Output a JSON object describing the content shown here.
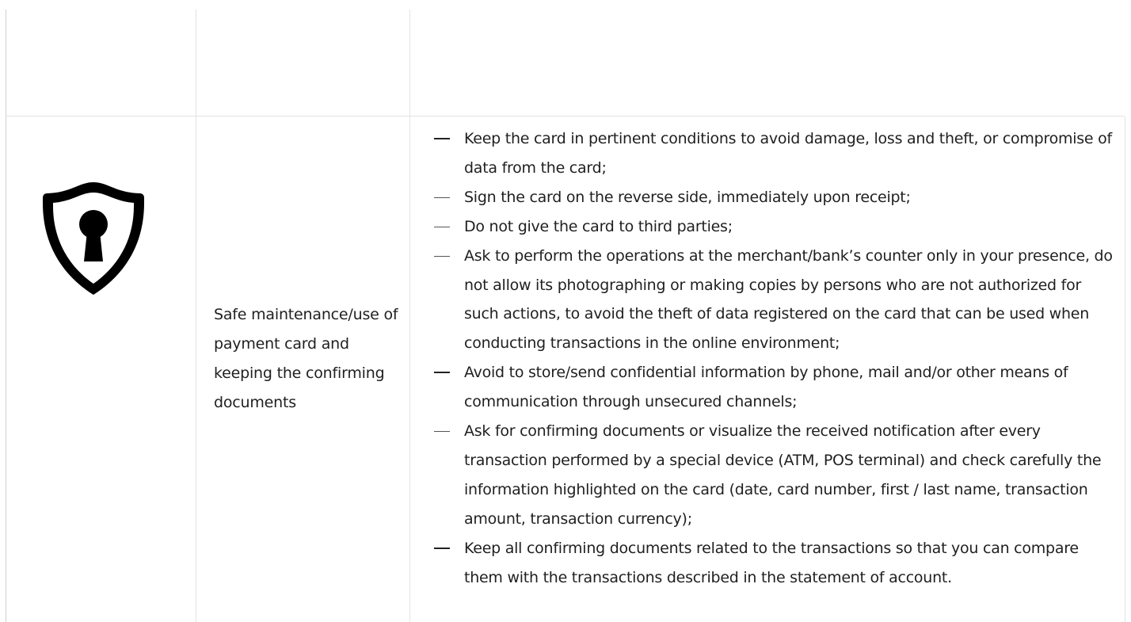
{
  "section": {
    "title": "Safe maintenance/use of payment card and keeping the confirming documents",
    "icon": "shield-keyhole-icon",
    "rules": [
      {
        "text": "Keep the card in pertinent conditions to avoid damage, loss and theft, or compromise of data from the card;",
        "bold_dash": true
      },
      {
        "text": "Sign the card on the reverse side, immediately upon receipt;",
        "bold_dash": false
      },
      {
        "text": "Do not give the card to third parties;",
        "bold_dash": false
      },
      {
        "text": "Ask to perform the operations at the merchant/bank’s counter only in your presence, do not allow its photographing or making copies by persons who are not authorized for such actions, to avoid the theft of data registered on the card that can be used when conducting transactions in the online environment;",
        "bold_dash": false
      },
      {
        "text": "Avoid to store/send confidential information by phone, mail and/or other means of communication through unsecured channels;",
        "bold_dash": true
      },
      {
        "text": "Ask for confirming documents or visualize the received notification after every transaction performed by a special device (ATM, POS terminal) and check carefully the information highlighted on the card (date, card number, first / last name, transaction amount, transaction currency);",
        "bold_dash": false
      },
      {
        "text": "Keep all confirming documents related to the transactions so that you can compare them with the transactions described in the statement of account.",
        "bold_dash": true
      }
    ]
  },
  "colors": {
    "text": "#1f1f1f",
    "grid": "#e3e3e3",
    "icon": "#000000"
  }
}
